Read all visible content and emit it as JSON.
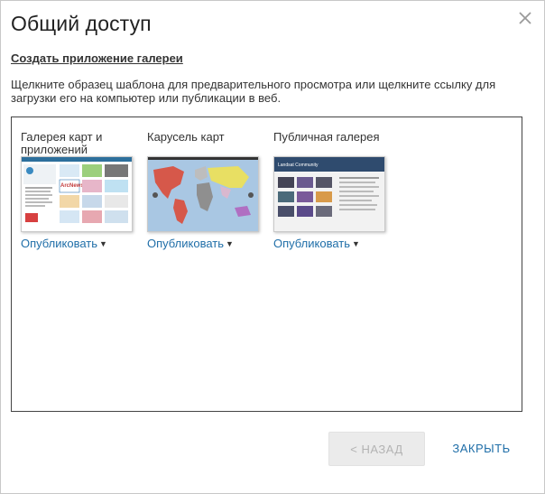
{
  "dialog": {
    "title": "Общий доступ",
    "subheading": "Создать приложение галереи",
    "description": "Щелкните образец шаблона для предварительного просмотра или щелкните ссылку для загрузки его на компьютер или публикации в веб.",
    "close_icon": "close-icon"
  },
  "templates": [
    {
      "label": "Галерея карт и приложений",
      "publish_label": "Опубликовать",
      "thumb_text": "ArcNews"
    },
    {
      "label": "Карусель карт",
      "publish_label": "Опубликовать"
    },
    {
      "label": "Публичная галерея",
      "publish_label": "Опубликовать",
      "thumb_text": "Landsat Community"
    }
  ],
  "footer": {
    "back_label": "< НАЗАД",
    "close_label": "ЗАКРЫТЬ"
  },
  "colors": {
    "link": "#1f6ea8",
    "disabled_button_bg": "#ebebeb",
    "disabled_button_text": "#b3b3b3"
  }
}
